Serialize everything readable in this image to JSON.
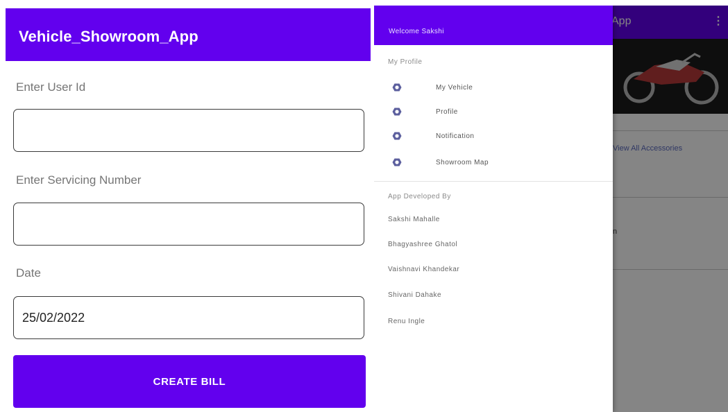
{
  "form_screen": {
    "app_title": "Vehicle_Showroom_App",
    "user_id": {
      "label": "Enter User Id",
      "value": ""
    },
    "servicing_number": {
      "label": "Enter Servicing Number",
      "value": ""
    },
    "date": {
      "label": "Date",
      "value": "25/02/2022"
    },
    "create_button_label": "CREATE BILL"
  },
  "drawer_screen": {
    "background_title": "App",
    "background_link": "View All Accessories",
    "header": {
      "welcome": "Welcome Sakshi"
    },
    "section_profile": "My Profile",
    "menu_items": [
      {
        "label": "My Vehicle",
        "icon": "profile-icon"
      },
      {
        "label": "Profile",
        "icon": "profile-icon"
      },
      {
        "label": "Notification",
        "icon": "profile-icon"
      },
      {
        "label": "Showroom Map",
        "icon": "profile-icon"
      }
    ],
    "section_developers": "App Developed By",
    "developers": [
      "Sakshi Mahalle",
      "Bhagyashree Ghatol",
      "Vaishnavi Khandekar",
      "Shivani Dahake",
      "Renu Ingle"
    ]
  },
  "colors": {
    "primary": "#6200ee",
    "icon_tint": "#5c5f9e"
  }
}
